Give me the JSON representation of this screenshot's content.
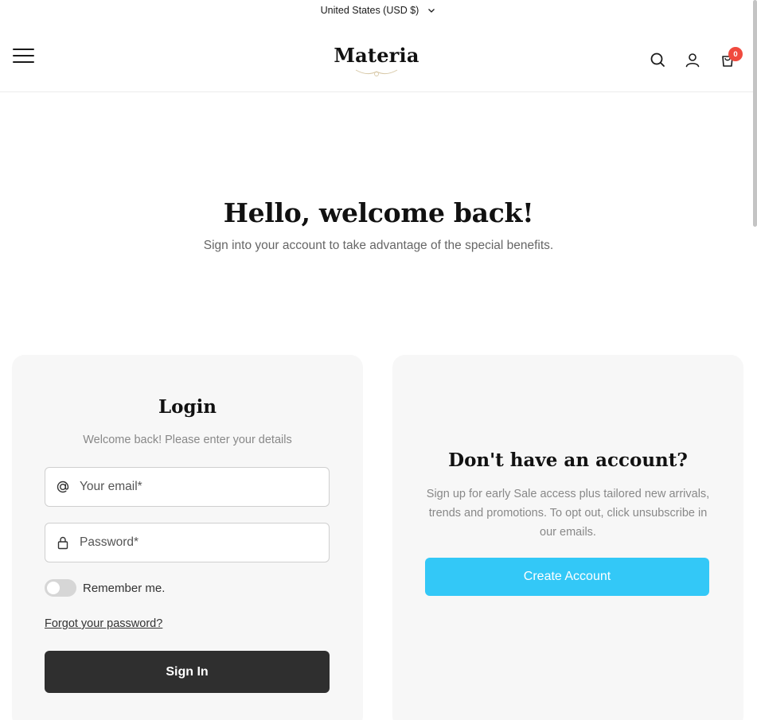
{
  "topbar": {
    "currency_selector": "United States (USD $)",
    "chevron_icon": "chevron-down-icon"
  },
  "header": {
    "logo_text": "Materia",
    "menu_icon": "hamburger-menu-icon",
    "search_icon": "search-icon",
    "account_icon": "user-icon",
    "cart_icon": "shopping-bag-icon",
    "cart_count": "0"
  },
  "hero": {
    "title": "Hello, welcome back!",
    "subtitle": "Sign into your account to take advantage of the special benefits."
  },
  "login": {
    "title": "Login",
    "subtitle": "Welcome back! Please enter your details",
    "email_placeholder": "Your email*",
    "email_icon": "at-sign-icon",
    "password_placeholder": "Password*",
    "password_icon": "lock-icon",
    "remember_label": "Remember me.",
    "remember_checked": false,
    "forgot_link": "Forgot your password?",
    "signin_label": "Sign In"
  },
  "register": {
    "title": "Don't have an account?",
    "description": "Sign up for early Sale access plus tailored new arrivals, trends and promotions. To opt out, click unsubscribe in our emails.",
    "create_label": "Create Account"
  },
  "colors": {
    "signin_button": "#2f2f2f",
    "create_button": "#33c8f7",
    "cart_badge": "#f04a3e",
    "card_background": "#f7f7f7"
  }
}
